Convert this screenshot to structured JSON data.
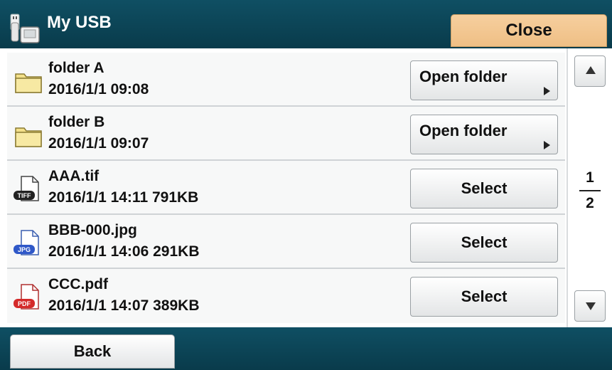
{
  "header": {
    "title": "My USB",
    "icon": "usb-drive-icon",
    "close_label": "Close",
    "color": "#0c4556",
    "close_color": "#f3c78f"
  },
  "files": [
    {
      "icon": "folder-icon",
      "name": "folder A",
      "meta": "2016/1/1 09:08",
      "action": "Open folder"
    },
    {
      "icon": "folder-icon",
      "name": "folder B",
      "meta": "2016/1/1 09:07",
      "action": "Open folder"
    },
    {
      "icon": "tiff-file-icon",
      "icon_label": "TIFF",
      "name": "AAA.tif",
      "meta": "2016/1/1 14:11 791KB",
      "action": "Select"
    },
    {
      "icon": "jpg-file-icon",
      "icon_label": "JPG",
      "name": "BBB-000.jpg",
      "meta": "2016/1/1 14:06 291KB",
      "action": "Select"
    },
    {
      "icon": "pdf-file-icon",
      "icon_label": "PDF",
      "name": "CCC.pdf",
      "meta": "2016/1/1 14:07 389KB",
      "action": "Select"
    }
  ],
  "pager": {
    "current": "1",
    "total": "2",
    "up_icon": "arrow-up-icon",
    "down_icon": "arrow-down-icon"
  },
  "footer": {
    "back_label": "Back"
  }
}
